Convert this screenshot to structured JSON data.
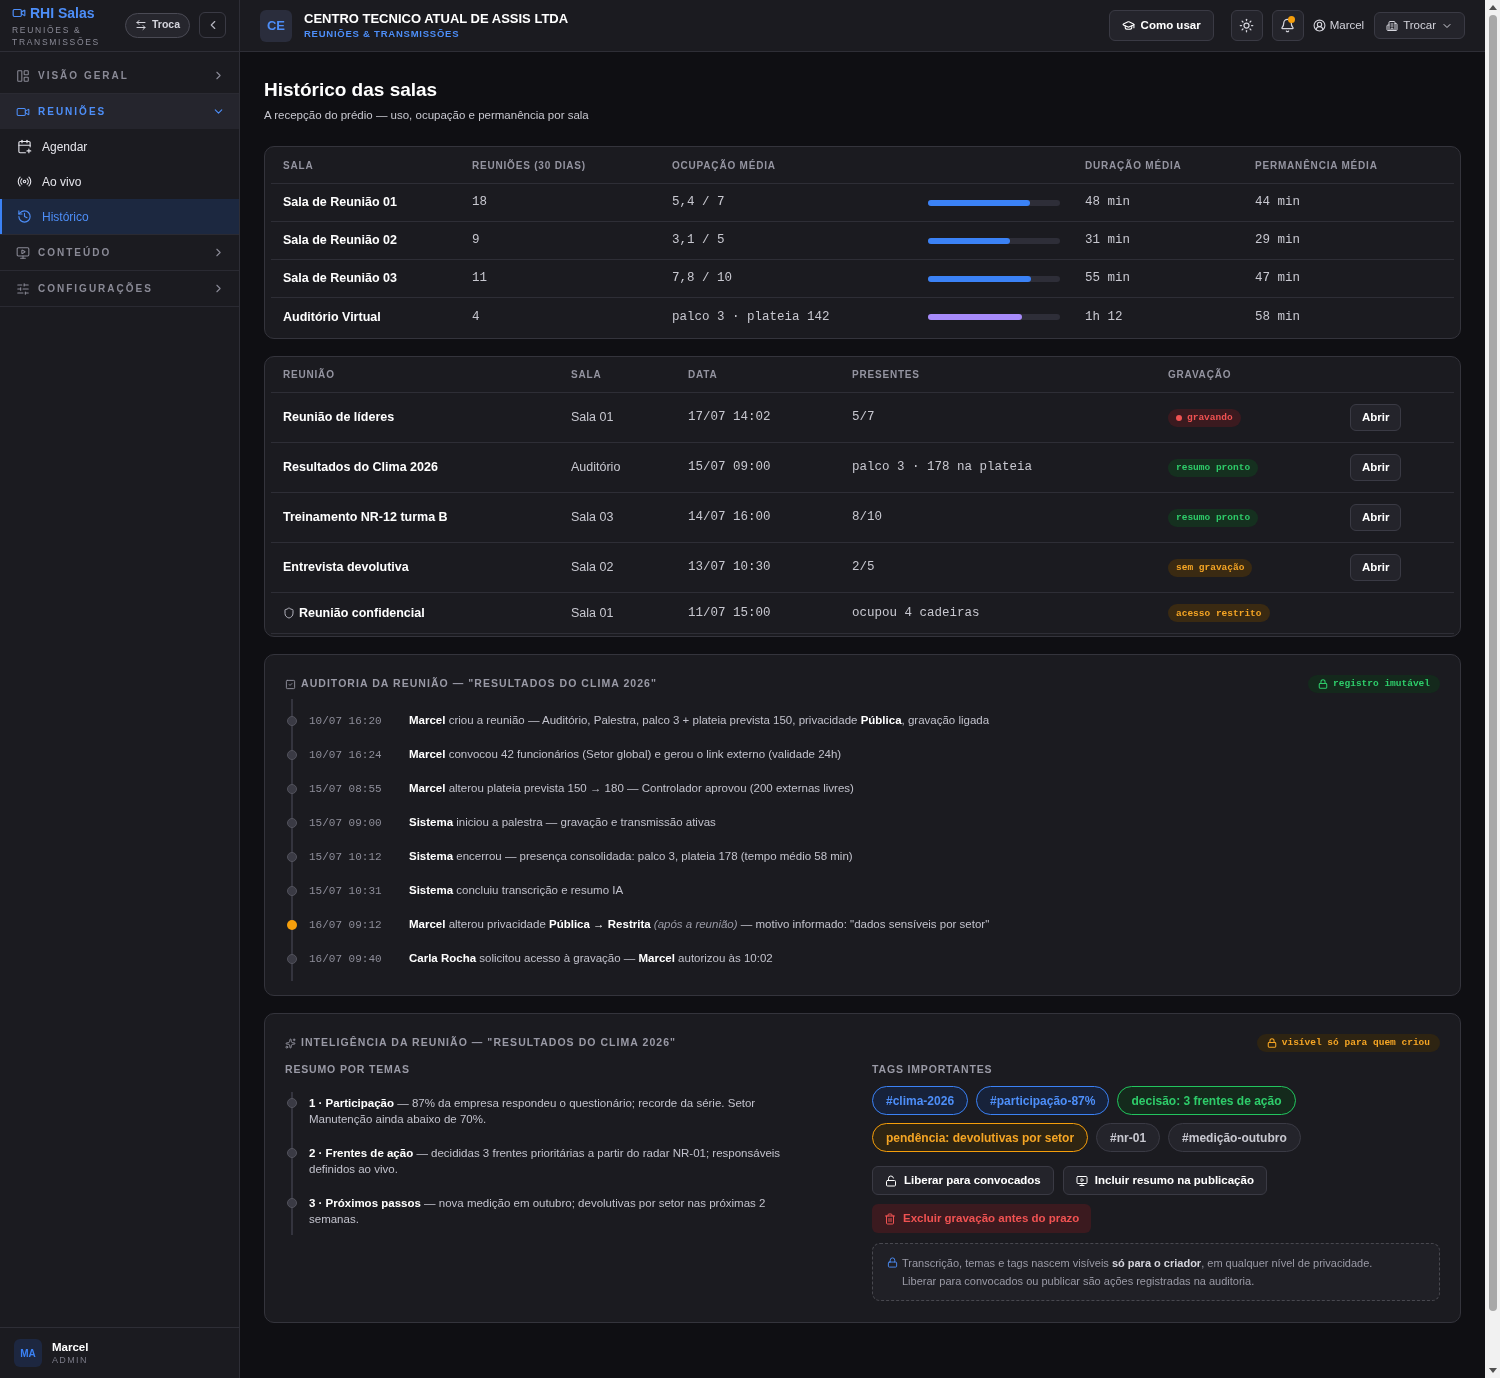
{
  "sidebar": {
    "brand": "RHI Salas",
    "brand_subtitle": "REUNIÕES & TRANSMISSÕES",
    "switch_button": "Troca",
    "nav": [
      {
        "label": "VISÃO GERAL",
        "expanded": false
      },
      {
        "label": "REUNIÕES",
        "expanded": true,
        "children": [
          {
            "label": "Agendar",
            "selected": false
          },
          {
            "label": "Ao vivo",
            "selected": false
          },
          {
            "label": "Histórico",
            "selected": true
          }
        ]
      },
      {
        "label": "CONTEÚDO",
        "expanded": false
      },
      {
        "label": "CONFIGURAÇÕES",
        "expanded": false
      }
    ],
    "user": {
      "initials": "MA",
      "name": "Marcel",
      "role": "ADMIN"
    }
  },
  "header": {
    "org_initials": "CE",
    "org_name": "CENTRO TECNICO ATUAL DE ASSIS LTDA",
    "org_subtitle": "REUNIÕES & TRANSMISSÕES",
    "help_button": "Como usar",
    "notifications_unread": true,
    "user_name": "Marcel",
    "switch_button": "Trocar"
  },
  "page": {
    "title": "Histórico das salas",
    "subtitle": "A recepção do prédio — uso, ocupação e permanência por sala"
  },
  "rooms_table": {
    "columns": [
      "SALA",
      "REUNIÕES (30 DIAS)",
      "OCUPAÇÃO MÉDIA",
      "DURAÇÃO MÉDIA",
      "PERMANÊNCIA MÉDIA"
    ],
    "rows": [
      {
        "name": "Sala de Reunião 01",
        "meetings": "18",
        "occupancy": "5,4 / 7",
        "level": 0.77,
        "color": "#3b82f6",
        "duration": "48 min",
        "stay": "44 min"
      },
      {
        "name": "Sala de Reunião 02",
        "meetings": "9",
        "occupancy": "3,1 / 5",
        "level": 0.62,
        "color": "#3b82f6",
        "duration": "31 min",
        "stay": "29 min"
      },
      {
        "name": "Sala de Reunião 03",
        "meetings": "11",
        "occupancy": "7,8 / 10",
        "level": 0.78,
        "color": "#3b82f6",
        "duration": "55 min",
        "stay": "47 min"
      },
      {
        "name": "Auditório Virtual",
        "meetings": "4",
        "occupancy": "palco 3 · plateia 142",
        "level": 0.71,
        "color": "#a78bfa",
        "duration": "1h 12",
        "stay": "58 min"
      }
    ]
  },
  "meetings_table": {
    "columns": [
      "REUNIÃO",
      "SALA",
      "DATA",
      "PRESENTES",
      "GRAVAÇÃO"
    ],
    "rows": [
      {
        "title": "Reunião de líderes",
        "confidential": false,
        "room": "Sala 01",
        "date": "17/07 14:02",
        "attendees": "5/7",
        "recording": {
          "label": "gravando",
          "kind": "live"
        },
        "action": "Abrir"
      },
      {
        "title": "Resultados do Clima 2026",
        "confidential": false,
        "room": "Auditório",
        "date": "15/07 09:00",
        "attendees": "palco 3 · 178 na plateia",
        "recording": {
          "label": "resumo pronto",
          "kind": "ready"
        },
        "action": "Abrir"
      },
      {
        "title": "Treinamento NR-12 turma B",
        "confidential": false,
        "room": "Sala 03",
        "date": "14/07 16:00",
        "attendees": "8/10",
        "recording": {
          "label": "resumo pronto",
          "kind": "ready"
        },
        "action": "Abrir"
      },
      {
        "title": "Entrevista devolutiva",
        "confidential": false,
        "room": "Sala 02",
        "date": "13/07 10:30",
        "attendees": "2/5",
        "recording": {
          "label": "sem gravação",
          "kind": "missing"
        },
        "action": "Abrir"
      },
      {
        "title": "Reunião confidencial",
        "confidential": true,
        "room": "Sala 01",
        "date": "11/07 15:00",
        "attendees": "ocupou 4 cadeiras",
        "recording": {
          "label": "acesso restrito",
          "kind": "restricted"
        }
      }
    ]
  },
  "audit": {
    "title": "AUDITORIA DA REUNIÃO — \"RESULTADOS DO CLIMA 2026\"",
    "badge": "registro imutável",
    "events": [
      {
        "time": "10/07 16:20",
        "text": "**Marcel** criou a reunião — Auditório, Palestra, palco 3 + plateia prevista 150, privacidade **Pública**, gravação ligada",
        "flagged": false
      },
      {
        "time": "10/07 16:24",
        "text": "**Marcel** convocou 42 funcionários (Setor global) e gerou o link externo (validade 24h)",
        "flagged": false
      },
      {
        "time": "15/07 08:55",
        "text": "**Marcel** alterou plateia prevista 150 → 180 — Controlador aprovou (200 externas livres)",
        "flagged": false
      },
      {
        "time": "15/07 09:00",
        "text": "**Sistema** iniciou a palestra — gravação e transmissão ativas",
        "flagged": false
      },
      {
        "time": "15/07 10:12",
        "text": "**Sistema** encerrou — presença consolidada: palco 3, plateia 178 (tempo médio 58 min)",
        "flagged": false
      },
      {
        "time": "15/07 10:31",
        "text": "**Sistema** concluiu transcrição e resumo IA",
        "flagged": false
      },
      {
        "time": "16/07 09:12",
        "text": "**Marcel** alterou privacidade **Pública → Restrita** *(após a reunião)* — motivo informado: \"dados sensíveis por setor\"",
        "flagged": true
      },
      {
        "time": "16/07 09:40",
        "text": "**Carla Rocha** solicitou acesso à gravação — **Marcel** autorizou às 10:02",
        "flagged": false
      }
    ]
  },
  "intelligence": {
    "title": "INTELIGÊNCIA DA REUNIÃO — \"RESULTADOS DO CLIMA 2026\"",
    "badge": "visível só para quem criou",
    "summary_label": "RESUMO POR TEMAS",
    "topics": [
      "**1 · Participação** — 87% da empresa respondeu o questionário; recorde da série. Setor Manutenção ainda abaixo de 70%.",
      "**2 · Frentes de ação** — decididas 3 frentes prioritárias a partir do radar NR-01; responsáveis definidos ao vivo.",
      "**3 · Próximos passos** — nova medição em outubro; devolutivas por setor nas próximas 2 semanas."
    ],
    "tags_label": "TAGS IMPORTANTES",
    "tags": [
      {
        "label": "#clima-2026",
        "kind": "highlight"
      },
      {
        "label": "#participação-87%",
        "kind": "highlight"
      },
      {
        "label": "decisão: 3 frentes de ação",
        "kind": "decision"
      },
      {
        "label": "pendência: devolutivas por setor",
        "kind": "pending"
      },
      {
        "label": "#nr-01",
        "kind": "neutral"
      },
      {
        "label": "#medição-outubro",
        "kind": "neutral"
      }
    ],
    "actions": [
      {
        "label": "Liberar para convocados",
        "kind": "release"
      },
      {
        "label": "Incluir resumo na publicação",
        "kind": "publish"
      },
      {
        "label": "Excluir gravação antes do prazo",
        "kind": "danger"
      }
    ],
    "note": [
      "Transcrição, temas e tags nascem visíveis **só para o criador**, em qualquer nível de privacidade.",
      "Liberar para convocados ou publicar são ações registradas na auditoria."
    ]
  }
}
